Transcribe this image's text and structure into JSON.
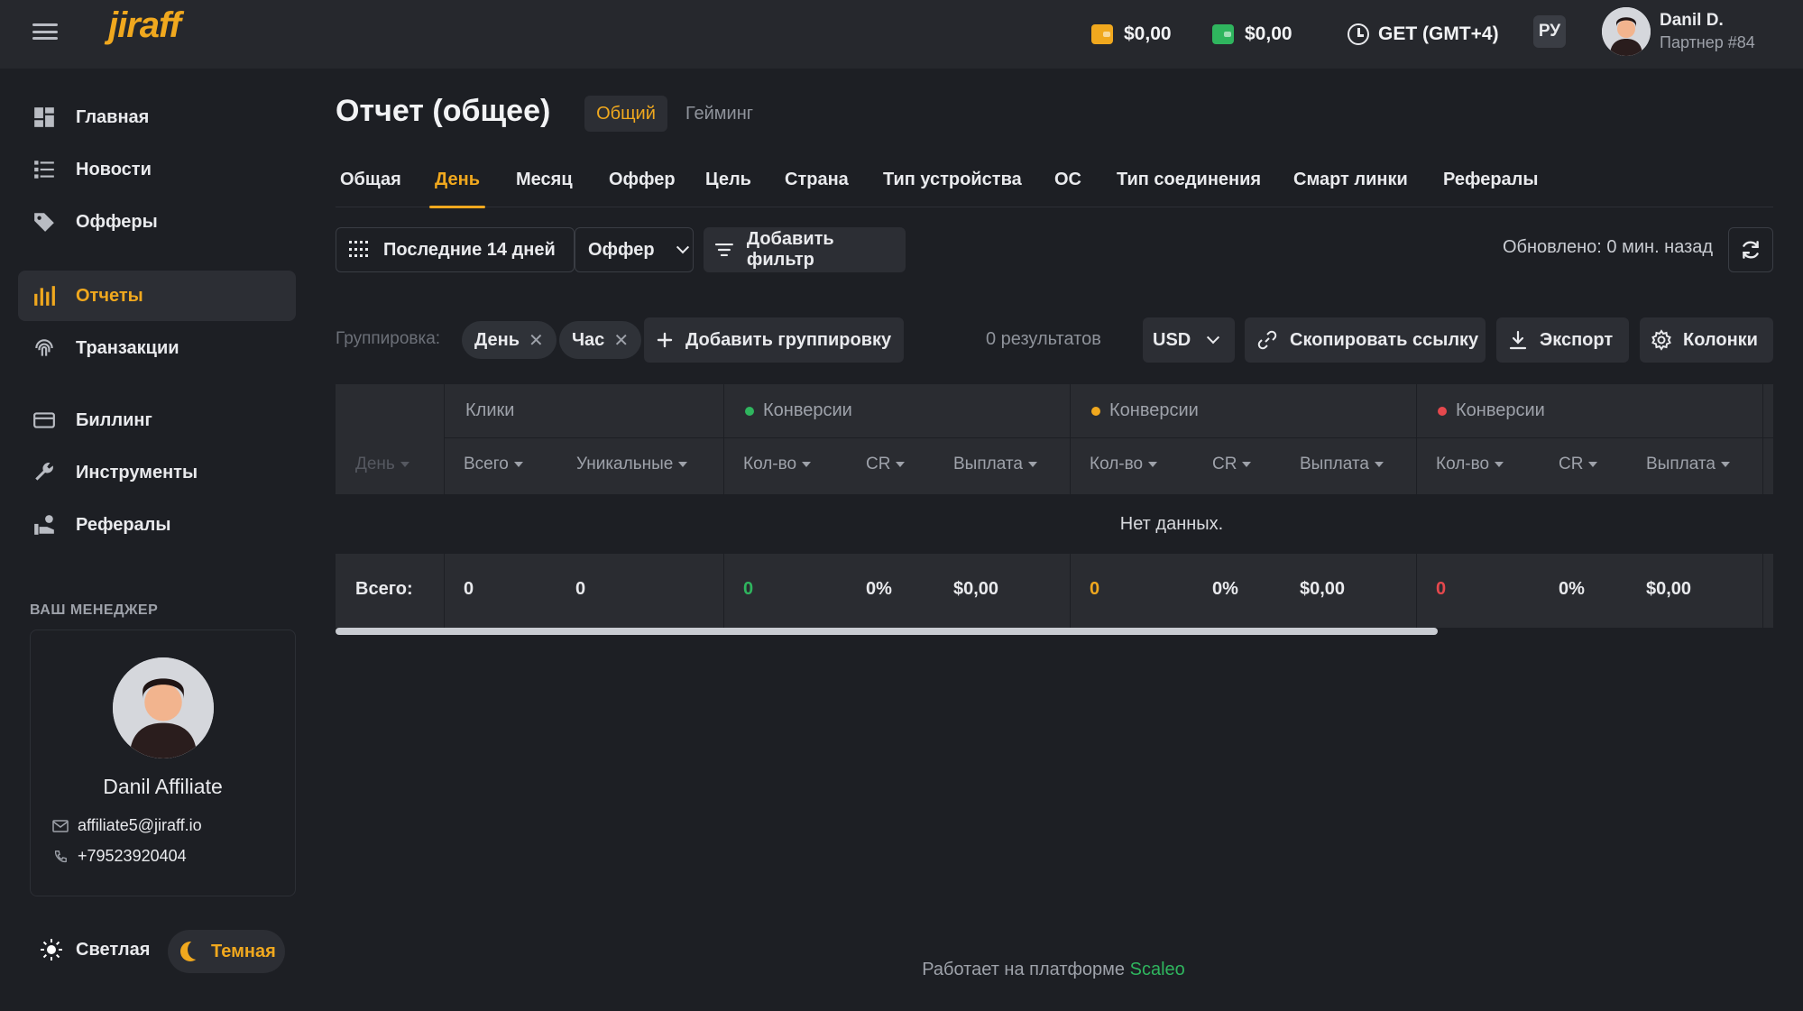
{
  "header": {
    "logo": "jiraff",
    "balance_1": "$0,00",
    "balance_2": "$0,00",
    "timezone": "GET (GMT+4)",
    "lang": "РУ",
    "user_name": "Danil D.",
    "user_sub": "Партнер #84"
  },
  "sidebar": {
    "items": [
      {
        "label": "Главная",
        "icon": "dashboard-icon"
      },
      {
        "label": "Новости",
        "icon": "news-icon"
      },
      {
        "label": "Офферы",
        "icon": "tag-icon"
      },
      {
        "label": "Отчеты",
        "icon": "bar-chart-icon",
        "active": true
      },
      {
        "label": "Транзакции",
        "icon": "fingerprint-icon"
      },
      {
        "label": "Биллинг",
        "icon": "card-icon"
      },
      {
        "label": "Инструменты",
        "icon": "wrench-icon"
      },
      {
        "label": "Рефералы",
        "icon": "referral-icon"
      }
    ],
    "manager_title": "ВАШ МЕНЕДЖЕР",
    "manager": {
      "name": "Danil Affiliate",
      "email": "affiliate5@jiraff.io",
      "phone": "+79523920404"
    },
    "theme_light": "Светлая",
    "theme_dark": "Темная"
  },
  "main": {
    "title": "Отчет (общее)",
    "mode_general": "Общий",
    "mode_gaming": "Гейминг",
    "tabs": [
      "Общая",
      "День",
      "Месяц",
      "Оффер",
      "Цель",
      "Страна",
      "Тип устройства",
      "ОС",
      "Тип соединения",
      "Смарт линки",
      "Рефералы"
    ],
    "active_tab": "День",
    "filters": {
      "date_range": "Последние 14 дней",
      "offer": "Оффер",
      "add_filter": "Добавить фильтр",
      "updated": "Обновлено: 0 мин. назад"
    },
    "grouping": {
      "label": "Группировка:",
      "chips": [
        "День",
        "Час"
      ],
      "add": "Добавить группировку",
      "results": "0  результатов",
      "currency": "USD",
      "copy_link": "Скопировать ссылку",
      "export": "Экспорт",
      "columns": "Колонки"
    },
    "table": {
      "groups": [
        "Клики",
        "Конверсии",
        "Конверсии",
        "Конверсии"
      ],
      "group_colors": [
        "",
        "#2fb55e",
        "#f0a81e",
        "#e5484d"
      ],
      "headers": [
        "День",
        "Всего",
        "Уникальные",
        "Кол-во",
        "CR",
        "Выплата",
        "Кол-во",
        "CR",
        "Выплата",
        "Кол-во",
        "CR",
        "Выплата"
      ],
      "empty": "Нет данных.",
      "totals_label": "Всего:",
      "totals": [
        "0",
        "0",
        "0",
        "0%",
        "$0,00",
        "0",
        "0%",
        "$0,00",
        "0",
        "0%",
        "$0,00"
      ]
    }
  },
  "footer": {
    "text": "Работает на платформе ",
    "brand": "Scaleo"
  }
}
